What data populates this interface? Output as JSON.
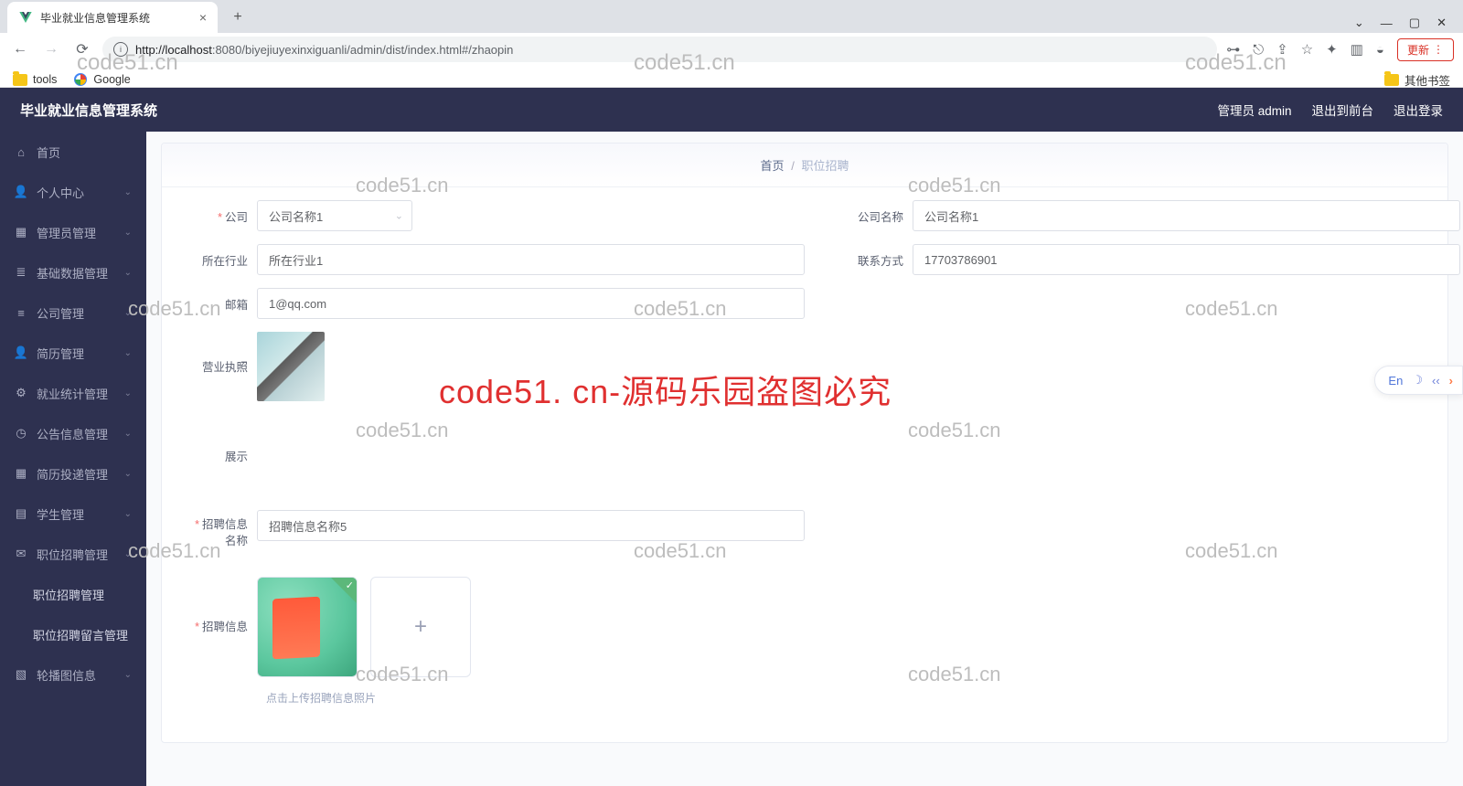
{
  "browser": {
    "tab_title": "毕业就业信息管理系统",
    "url_host": "http://localhost",
    "url_port": ":8080",
    "url_path": "/biyejiuyexinxiguanli/admin/dist/index.html#/zhaopin",
    "update_label": "更新",
    "bookmarks": {
      "tools": "tools",
      "google": "Google",
      "other": "其他书签"
    }
  },
  "header": {
    "title": "毕业就业信息管理系统",
    "user": "管理员 admin",
    "front": "退出到前台",
    "logout": "退出登录"
  },
  "sidebar": {
    "items": [
      {
        "label": "首页"
      },
      {
        "label": "个人中心"
      },
      {
        "label": "管理员管理"
      },
      {
        "label": "基础数据管理"
      },
      {
        "label": "公司管理"
      },
      {
        "label": "简历管理"
      },
      {
        "label": "就业统计管理"
      },
      {
        "label": "公告信息管理"
      },
      {
        "label": "简历投递管理"
      },
      {
        "label": "学生管理"
      },
      {
        "label": "职位招聘管理"
      },
      {
        "label": "职位招聘管理",
        "sub": true
      },
      {
        "label": "职位招聘留言管理",
        "sub": true
      },
      {
        "label": "轮播图信息"
      }
    ]
  },
  "breadcrumb": {
    "home": "首页",
    "current": "职位招聘"
  },
  "form": {
    "company_label": "公司",
    "company_value": "公司名称1",
    "company_name_label": "公司名称",
    "company_name_value": "公司名称1",
    "industry_label": "所在行业",
    "industry_value": "所在行业1",
    "contact_label": "联系方式",
    "contact_value": "17703786901",
    "email_label": "邮箱",
    "email_value": "1@qq.com",
    "license_label": "营业执照",
    "display_label": "展示",
    "recruit_name_label": "招聘信息名称",
    "recruit_name_value": "招聘信息名称5",
    "recruit_info_label": "招聘信息",
    "recruit_info_hint": "点击上传招聘信息照片"
  },
  "watermark": {
    "gray": "code51.cn",
    "red": "code51. cn-源码乐园盗图必究"
  },
  "fab": {
    "lang": "En"
  }
}
